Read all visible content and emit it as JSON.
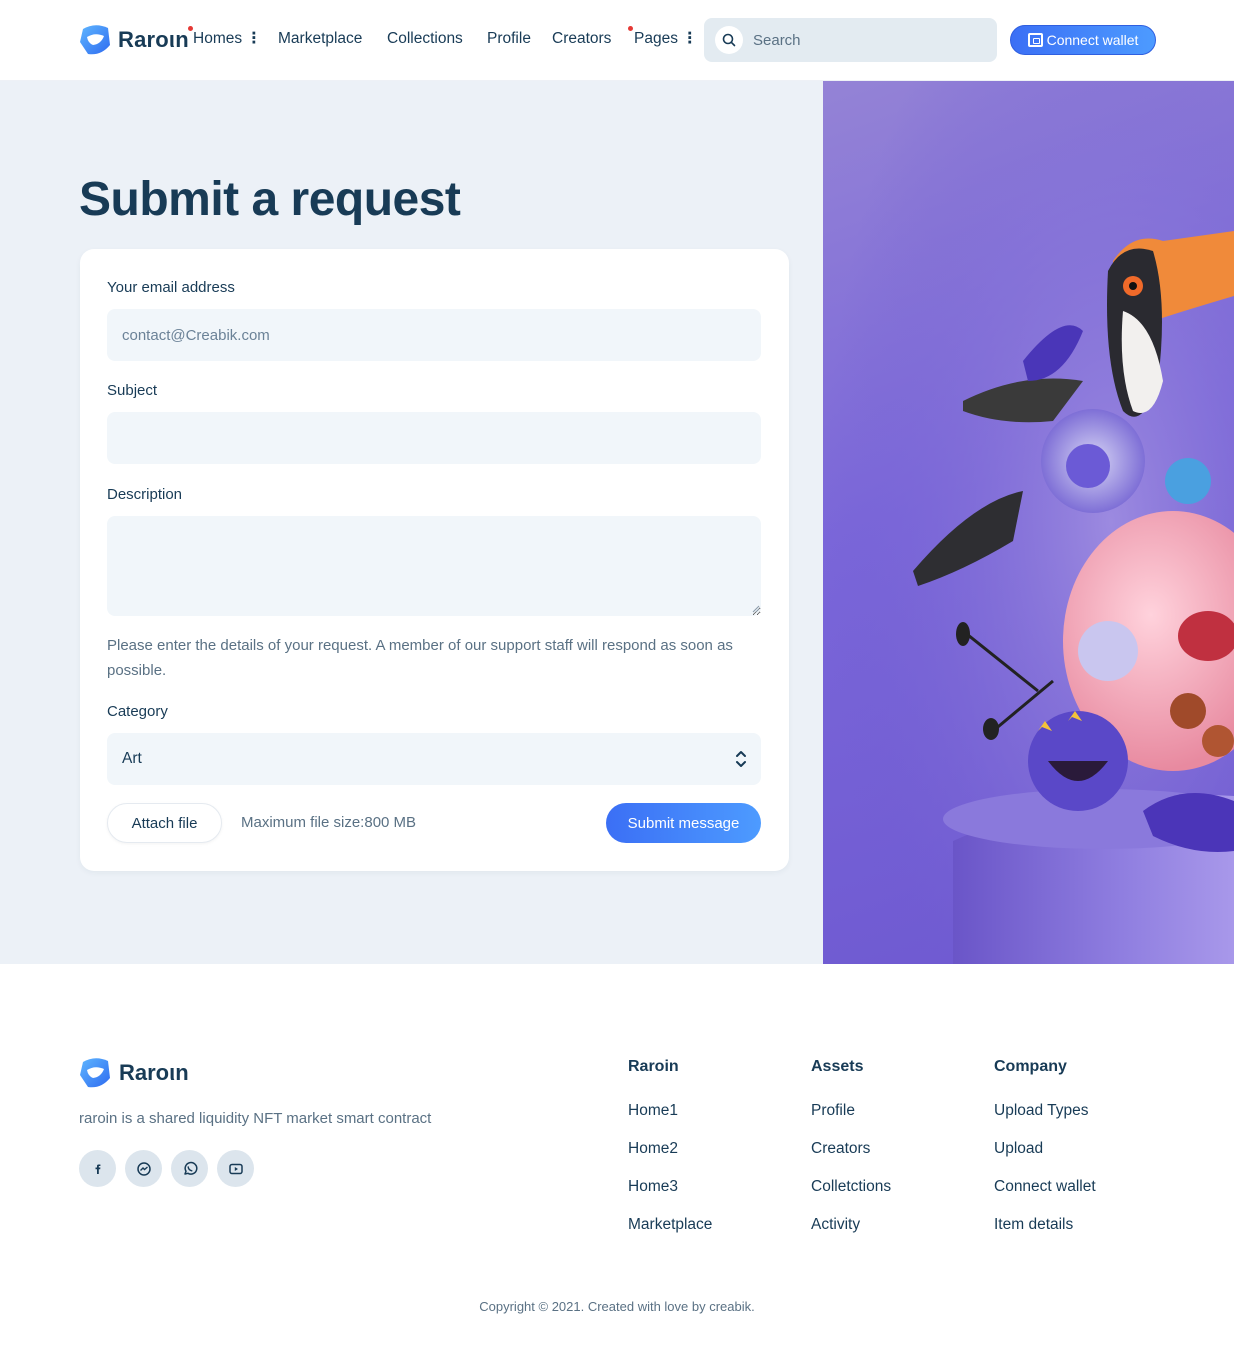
{
  "brand": {
    "name": "Raroιn"
  },
  "nav": {
    "items": [
      {
        "label": "Homes",
        "has_menu": true,
        "dot": true
      },
      {
        "label": "Marketplace"
      },
      {
        "label": "Collections"
      },
      {
        "label": "Profile"
      },
      {
        "label": "Creators"
      },
      {
        "label": "Pages",
        "has_menu": true,
        "dot": true
      }
    ],
    "menu_glyph": "⋮"
  },
  "search": {
    "placeholder": "Search",
    "icon": "search-icon"
  },
  "header": {
    "connect_label": "Connect wallet",
    "connect_icon": "wallet-icon"
  },
  "main": {
    "title": "Submit a request",
    "form": {
      "email_label": "Your email address",
      "email_placeholder": "contact@Creabik.com",
      "subject_label": "Subject",
      "subject_value": "",
      "description_label": "Description",
      "description_value": "",
      "help_text": "Please enter the details of your request. A member of our support staff will respond as soon as possible.",
      "category_label": "Category",
      "category_value": "Art",
      "attach_label": "Attach file",
      "max_size_text": "Maximum file size:800 MB",
      "submit_label": "Submit message"
    }
  },
  "footer": {
    "brand": "Raroιn",
    "tagline": "raroin is a shared liquidity NFT market smart contract",
    "socials": [
      "facebook-icon",
      "messenger-icon",
      "whatsapp-icon",
      "youtube-icon"
    ],
    "columns": [
      {
        "title": "Raroin",
        "links": [
          "Home1",
          "Home2",
          "Home3",
          "Marketplace"
        ]
      },
      {
        "title": "Assets",
        "links": [
          "Profile",
          "Creators",
          "Colletctions",
          "Activity"
        ]
      },
      {
        "title": "Company",
        "links": [
          "Upload Types",
          "Upload",
          "Connect wallet",
          "Item details"
        ]
      }
    ],
    "copyright": "Copyright © 2021. Created with love by creabik."
  },
  "colors": {
    "primary": "#3b6ff5",
    "text": "#183b56",
    "muted": "#5a7184",
    "bg": "#ecf1f7",
    "accent_dot": "#e53935"
  }
}
